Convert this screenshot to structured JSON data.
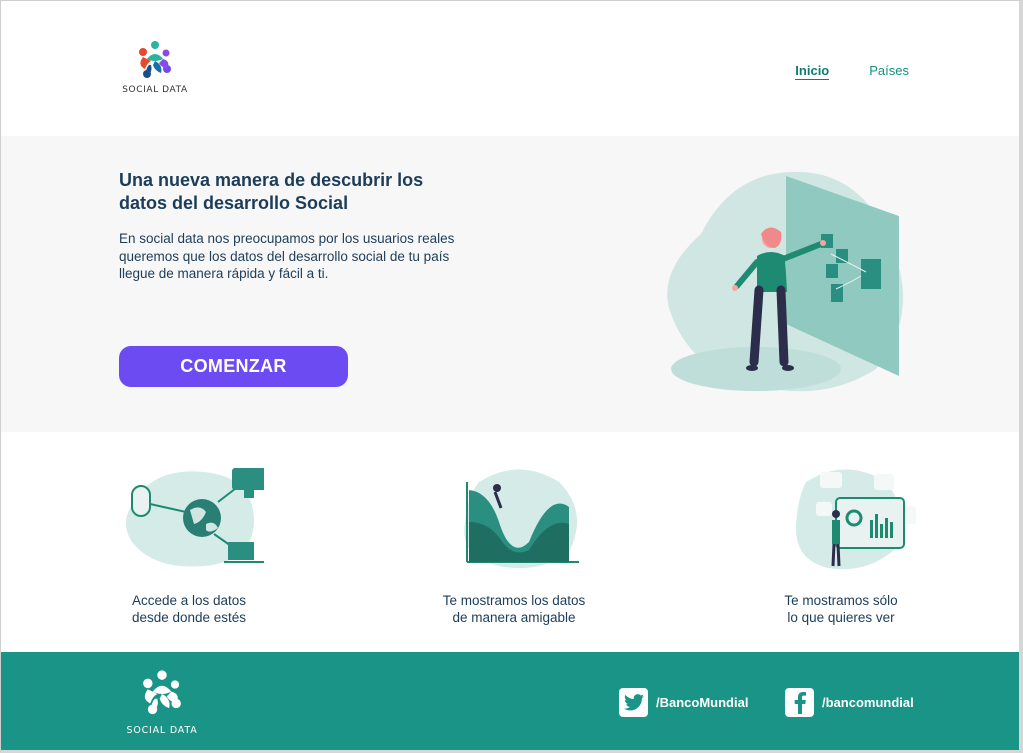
{
  "brand": {
    "name": "SOCIAL DATA"
  },
  "nav": {
    "items": [
      {
        "label": "Inicio",
        "active": true
      },
      {
        "label": "Países",
        "active": false
      }
    ]
  },
  "hero": {
    "title_line1": "Una nueva manera de descubrir los",
    "title_line2": "datos del desarrollo Social",
    "text_line1": "En social data nos preocupamos por los usuarios reales",
    "text_line2": "queremos que los datos del desarrollo social de tu país",
    "text_line3": "llegue de manera rápida y fácil a ti.",
    "cta_label": "COMENZAR"
  },
  "features": [
    {
      "line1": "Accede a los datos",
      "line2": "desde donde estés",
      "icon": "globe-devices-icon"
    },
    {
      "line1": "Te mostramos los datos",
      "line2": "de manera amigable",
      "icon": "area-chart-icon"
    },
    {
      "line1": "Te mostramos sólo",
      "line2": "lo que quieres ver",
      "icon": "dashboard-presenter-icon"
    }
  ],
  "footer": {
    "twitter": "/BancoMundial",
    "facebook": "/bancomundial"
  },
  "colors": {
    "teal": "#199486",
    "navy": "#1c3d5a",
    "purple": "#6c4cf2",
    "hero_bg": "#f7f7f7"
  }
}
